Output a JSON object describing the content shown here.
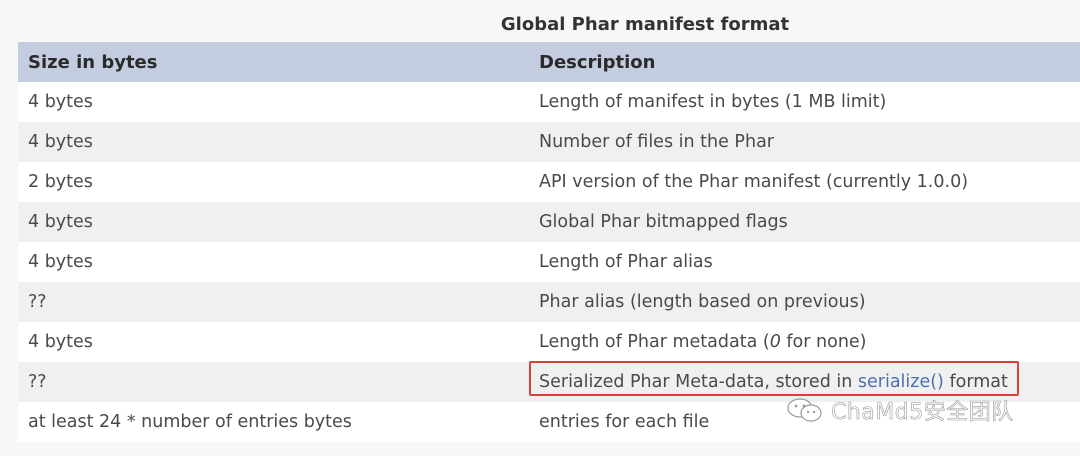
{
  "caption": "Global Phar manifest format",
  "columns": [
    "Size in bytes",
    "Description"
  ],
  "rows": [
    {
      "size": "4 bytes",
      "desc": "Length of manifest in bytes (1 MB limit)"
    },
    {
      "size": "4 bytes",
      "desc": "Number of files in the Phar"
    },
    {
      "size": "2 bytes",
      "desc": "API version of the Phar manifest (currently 1.0.0)"
    },
    {
      "size": "4 bytes",
      "desc": "Global Phar bitmapped flags"
    },
    {
      "size": "4 bytes",
      "desc": "Length of Phar alias"
    },
    {
      "size": "??",
      "desc": "Phar alias (length based on previous)"
    },
    {
      "size": "4 bytes",
      "desc_pre": "Length of Phar metadata (",
      "desc_em": "0",
      "desc_post": " for none)"
    },
    {
      "size": "??",
      "desc_pre": "Serialized Phar Meta-data, stored in ",
      "desc_link": "serialize()",
      "desc_post": " format"
    },
    {
      "size": "at least 24 * number of entries bytes",
      "desc": "entries for each file"
    }
  ],
  "watermark": "ChaMd5安全团队",
  "colors": {
    "header_bg": "#c4cde0",
    "highlight_border": "#d9423a",
    "link": "#4b6fb3"
  }
}
